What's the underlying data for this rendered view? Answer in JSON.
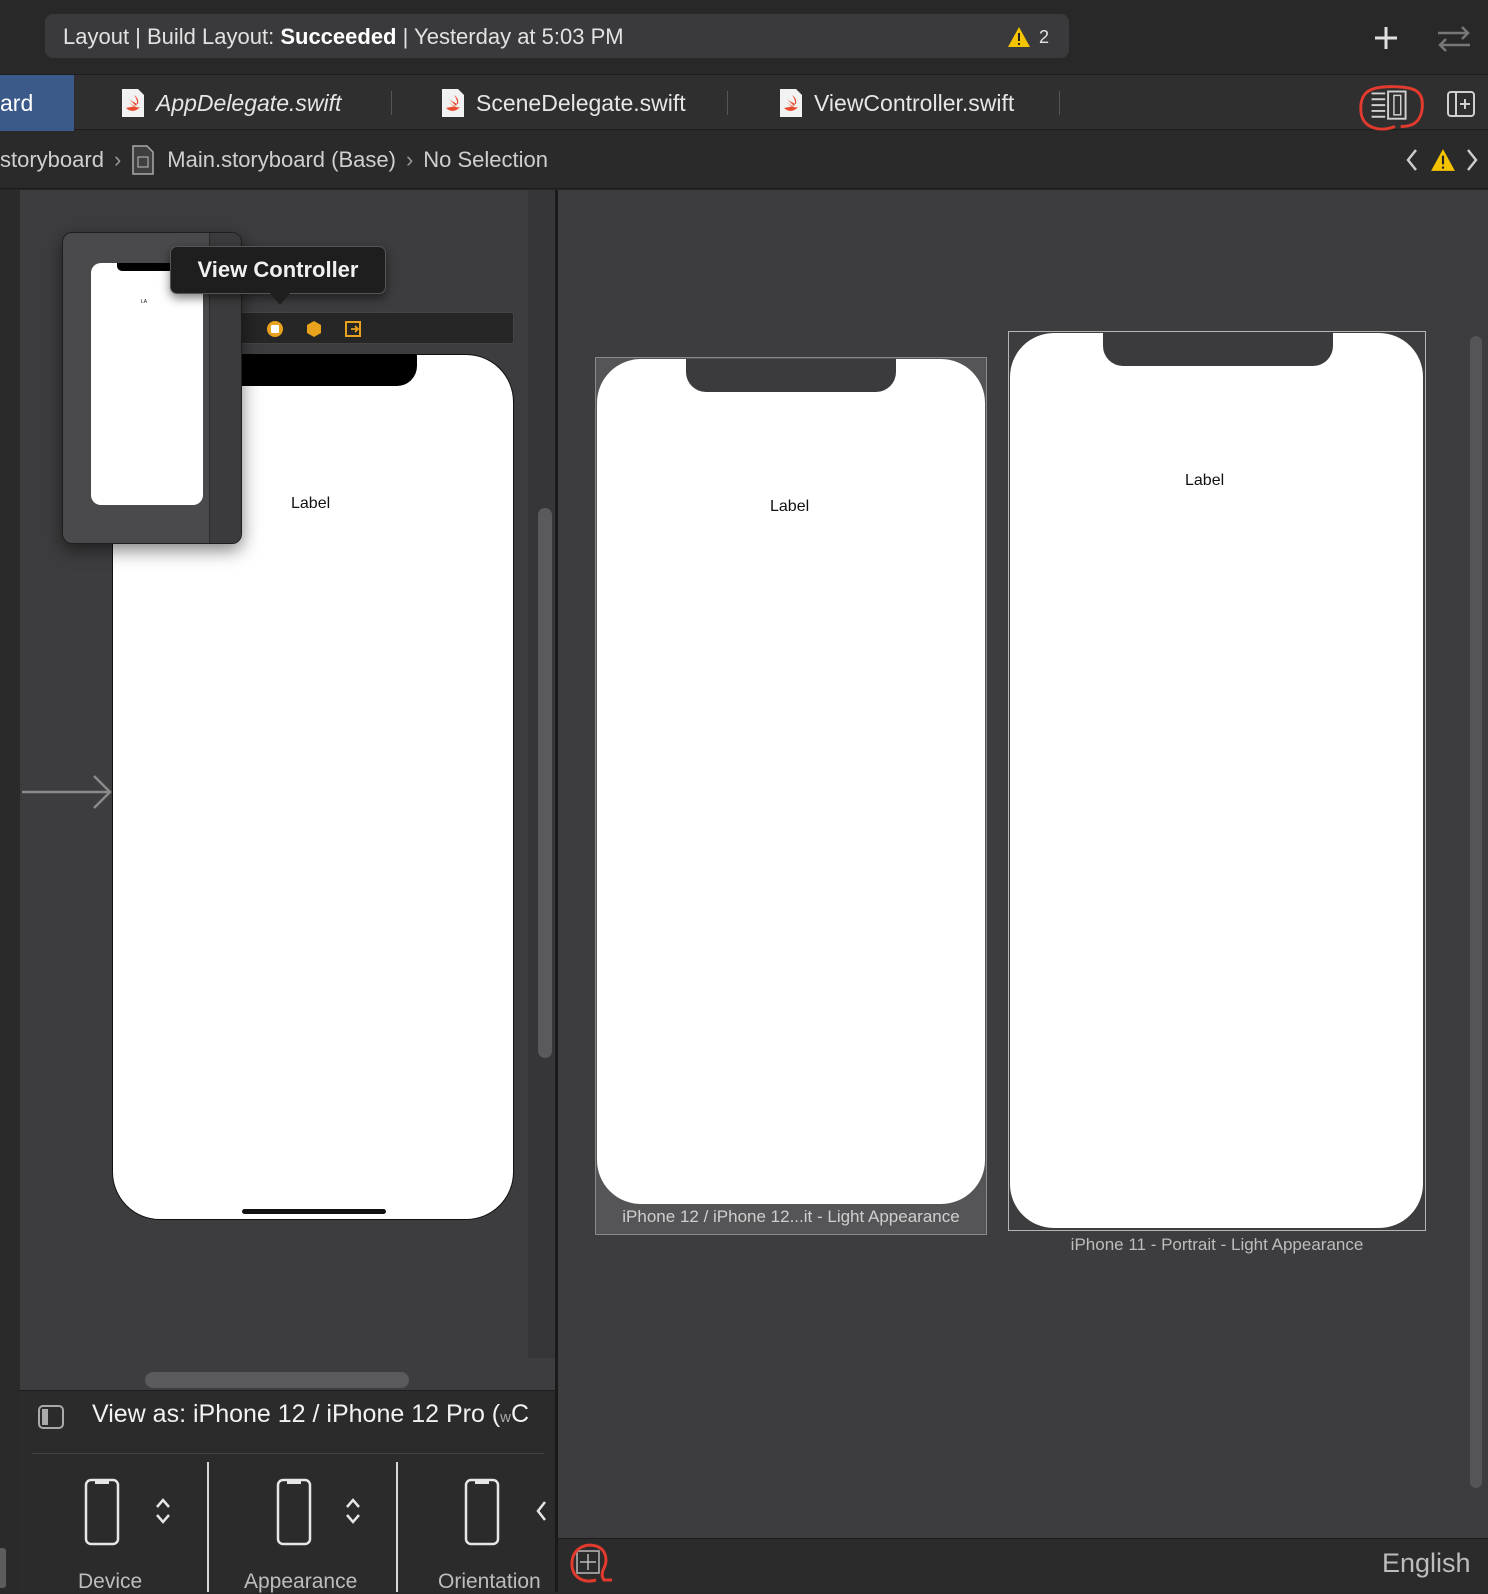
{
  "toolbar": {
    "status_prefix": "Layout | Build Layout:",
    "status_bold": "Succeeded",
    "status_suffix": "| Yesterday at 5:03 PM",
    "warning_count": "2",
    "add_icon": "plus-icon",
    "split_icon": "swap-arrows-icon"
  },
  "tabs": {
    "active_partial": "ard",
    "items": [
      {
        "label": "AppDelegate.swift",
        "icon": "swift-file-icon"
      },
      {
        "label": "SceneDelegate.swift",
        "icon": "swift-file-icon"
      },
      {
        "label": "ViewController.swift",
        "icon": "swift-file-icon"
      }
    ],
    "right_icons": [
      "adjust-editor-options-icon",
      "add-editor-icon"
    ]
  },
  "jumpbar": {
    "crumb0": "storyboard",
    "crumb1": "Main.storyboard (Base)",
    "crumb2": "No Selection"
  },
  "scene": {
    "tooltip": "View Controller",
    "label": "Label",
    "mini_label": "LA"
  },
  "previews": [
    {
      "label": "Label",
      "caption": "iPhone 12 / iPhone 12...it - Light Appearance"
    },
    {
      "label": "Label",
      "caption": "iPhone 11 - Portrait - Light Appearance"
    }
  ],
  "device_config": {
    "view_as": "View as: iPhone 12 / iPhone 12 Pro (",
    "view_as_small": "w",
    "view_as_end": "C",
    "options": [
      {
        "label": "Device"
      },
      {
        "label": "Appearance"
      },
      {
        "label": "Orientation"
      }
    ]
  },
  "preview_footer": {
    "language": "English"
  },
  "colors": {
    "accent_red": "#e23b2e",
    "active_tab": "#3b5a8a",
    "warning_yellow": "#f5c400"
  }
}
